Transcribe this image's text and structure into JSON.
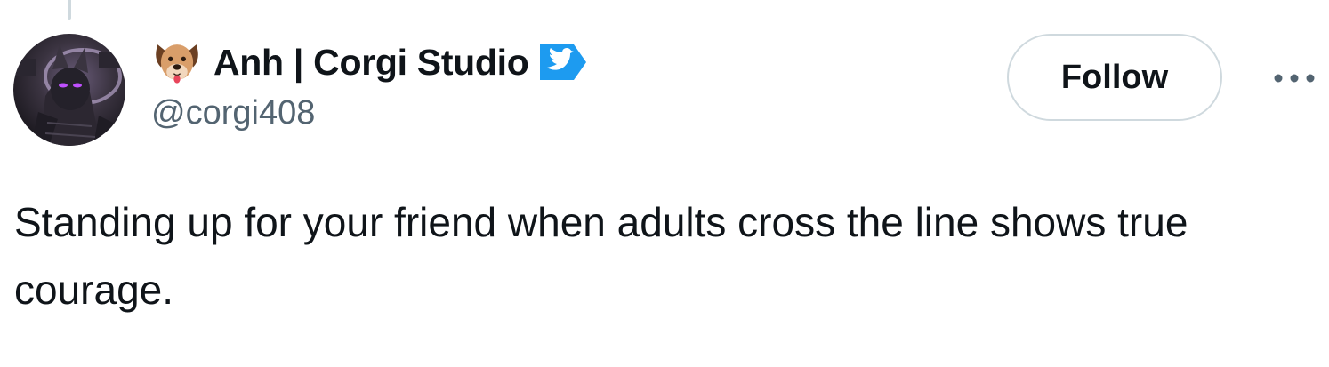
{
  "tweet": {
    "author": {
      "display_name": "Anh | Corgi Studio",
      "handle": "@corgi408",
      "name_emoji_icon": "dog-face-icon",
      "verified_badge_icon": "blue-bird-verified-icon",
      "avatar_icon": "dark-hooded-character-avatar"
    },
    "follow_label": "Follow",
    "more_icon": "more-dots-icon",
    "text": "Standing up for your friend when adults cross the line shows true courage."
  },
  "colors": {
    "text_primary": "#0f1419",
    "text_secondary": "#536471",
    "border": "#cfd9de",
    "verified_blue": "#1d9bf0"
  }
}
